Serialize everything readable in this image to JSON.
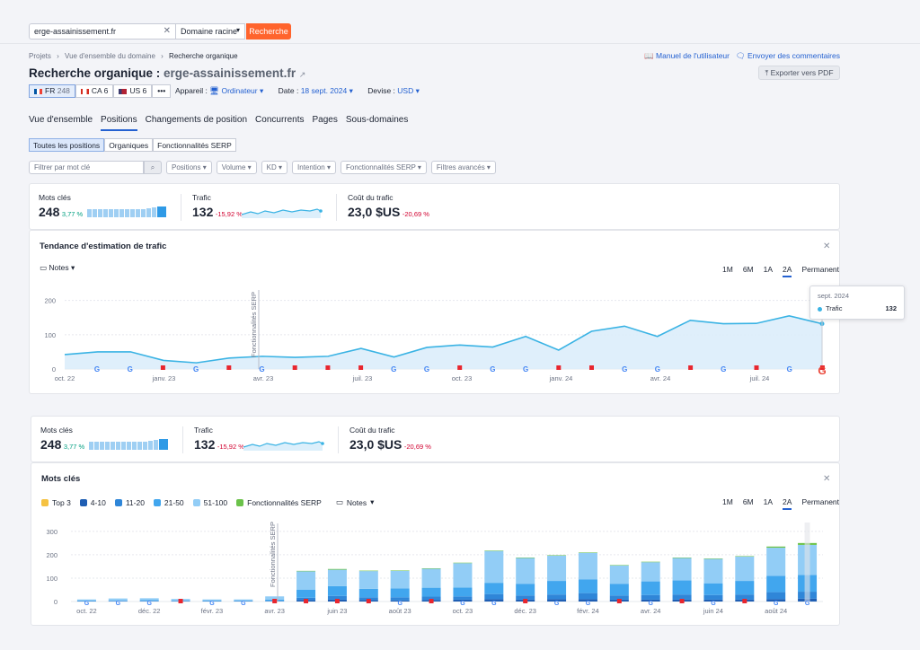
{
  "search": {
    "value": "erge-assainissement.fr",
    "scope": "Domaine racine",
    "button": "Recherche"
  },
  "breadcrumb": [
    "Projets",
    "Vue d'ensemble du domaine",
    "Recherche organique"
  ],
  "links": {
    "manual": "Manuel de l'utilisateur",
    "feedback": "Envoyer des commentaires"
  },
  "title": {
    "prefix": "Recherche organique : ",
    "domain": "erge-assainissement.fr"
  },
  "export": "Exporter vers PDF",
  "dbs": [
    {
      "code": "FR",
      "count": "248",
      "colors": [
        "#0055a4",
        "#ffffff",
        "#ef4135"
      ]
    },
    {
      "code": "CA",
      "count": "6",
      "colors": [
        "#d52b1e",
        "#ffffff",
        "#d52b1e"
      ]
    },
    {
      "code": "US",
      "count": "6",
      "colors": [
        "#3c3b6e",
        "#ffffff",
        "#b22234"
      ]
    },
    {
      "code": "•••",
      "count": ""
    }
  ],
  "options": {
    "device_label": "Appareil : ",
    "device": "Ordinateur",
    "date_label": "Date : ",
    "date": "18 sept. 2024",
    "currency_label": "Devise : ",
    "currency": "USD"
  },
  "tabs": [
    "Vue d'ensemble",
    "Positions",
    "Changements de position",
    "Concurrents",
    "Pages",
    "Sous-domaines"
  ],
  "subtabs": [
    "Toutes les positions",
    "Organiques",
    "Fonctionnalités SERP"
  ],
  "filters": {
    "placeholder": "Filtrer par mot clé",
    "items": [
      "Positions",
      "Volume",
      "KD",
      "Intention",
      "Fonctionnalités SERP",
      "Filtres avancés"
    ]
  },
  "summary": {
    "keywords_label": "Mots clés",
    "keywords": "248",
    "keywords_delta": "3,77 %",
    "traffic_label": "Trafic",
    "traffic": "132",
    "traffic_delta": "-15,92 %",
    "cost_label": "Coût du trafic",
    "cost": "23,0 $US",
    "cost_delta": "-20,69 %"
  },
  "trend": {
    "title": "Tendance d'estimation de trafic",
    "notes": "Notes",
    "ranges": [
      "1M",
      "6M",
      "1A",
      "2A",
      "Permanent"
    ],
    "active_range": "2A",
    "serp_marker": "Fonctionnalités SERP",
    "tooltip": {
      "date": "sept. 2024",
      "series": "Trafic",
      "value": "132"
    }
  },
  "keywords_panel": {
    "title": "Mots clés",
    "legend": [
      {
        "label": "Top 3",
        "color": "#f5c242"
      },
      {
        "label": "4-10",
        "color": "#1f5eb3"
      },
      {
        "label": "11-20",
        "color": "#2f86d8"
      },
      {
        "label": "21-50",
        "color": "#41a6ee"
      },
      {
        "label": "51-100",
        "color": "#92cdf6"
      },
      {
        "label": "Fonctionnalités SERP",
        "color": "#6bc24a"
      }
    ],
    "notes": "Notes",
    "ranges": [
      "1M",
      "6M",
      "1A",
      "2A",
      "Permanent"
    ],
    "active_range": "2A",
    "serp_marker": "Fonctionnalités SERP"
  },
  "chart_data": [
    {
      "type": "area",
      "title": "Tendance d'estimation de trafic",
      "x_ticks": [
        "oct. 22",
        "janv. 23",
        "avr. 23",
        "juil. 23",
        "oct. 23",
        "janv. 24",
        "avr. 24",
        "juil. 24"
      ],
      "y_ticks": [
        0,
        100,
        200
      ],
      "ylim": [
        0,
        220
      ],
      "series": [
        {
          "name": "Trafic",
          "values": [
            42,
            50,
            50,
            25,
            18,
            32,
            37,
            34,
            37,
            60,
            35,
            63,
            70,
            64,
            95,
            55,
            110,
            125,
            95,
            142,
            132,
            133,
            155,
            132
          ]
        }
      ]
    },
    {
      "type": "bar",
      "title": "Mots clés",
      "x_ticks": [
        "oct. 22",
        "déc. 22",
        "févr. 23",
        "avr. 23",
        "juin 23",
        "août 23",
        "oct. 23",
        "déc. 23",
        "févr. 24",
        "avr. 24",
        "juin 24",
        "août 24"
      ],
      "y_ticks": [
        0,
        100,
        200,
        300
      ],
      "ylim": [
        0,
        330
      ],
      "stack_order": [
        "4-10",
        "11-20",
        "21-50",
        "51-100",
        "Fonctionnalités SERP"
      ],
      "stacks": [
        [
          1,
          1,
          2,
          5,
          0
        ],
        [
          1,
          2,
          2,
          8,
          0
        ],
        [
          1,
          2,
          3,
          8,
          0
        ],
        [
          1,
          2,
          2,
          6,
          0
        ],
        [
          1,
          1,
          2,
          5,
          0
        ],
        [
          1,
          1,
          2,
          5,
          0
        ],
        [
          1,
          2,
          5,
          14,
          0
        ],
        [
          6,
          10,
          35,
          78,
          2
        ],
        [
          8,
          16,
          42,
          70,
          3
        ],
        [
          6,
          12,
          36,
          76,
          2
        ],
        [
          5,
          13,
          38,
          75,
          2
        ],
        [
          6,
          15,
          38,
          81,
          2
        ],
        [
          8,
          14,
          38,
          104,
          2
        ],
        [
          10,
          22,
          48,
          136,
          2
        ],
        [
          8,
          18,
          50,
          110,
          2
        ],
        [
          10,
          20,
          58,
          108,
          2
        ],
        [
          10,
          26,
          58,
          114,
          2
        ],
        [
          8,
          18,
          50,
          78,
          2
        ],
        [
          8,
          20,
          58,
          82,
          2
        ],
        [
          8,
          22,
          60,
          96,
          2
        ],
        [
          8,
          20,
          50,
          104,
          2
        ],
        [
          8,
          22,
          58,
          104,
          2
        ],
        [
          10,
          30,
          70,
          120,
          5
        ],
        [
          12,
          30,
          72,
          128,
          8
        ]
      ]
    }
  ]
}
